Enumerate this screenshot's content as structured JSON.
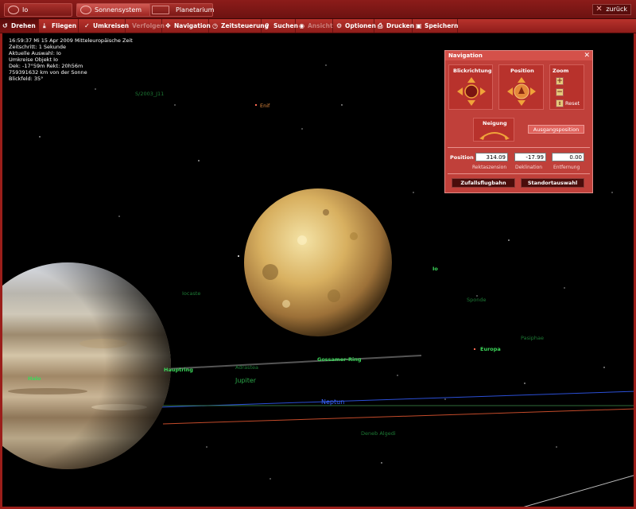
{
  "tabs": {
    "io": "Io",
    "sonnensystem": "Sonnensystem",
    "planetarium": "Planetarium",
    "back": "zurück"
  },
  "toolbar": {
    "drehen": "Drehen",
    "fliegen": "Fliegen",
    "umkreisen": "Umkreisen",
    "verfolgen": "Verfolgen",
    "navigation": "Navigation",
    "zeitsteuerung": "Zeitsteuerung",
    "suchen": "Suchen",
    "ansicht": "Ansicht",
    "optionen": "Optionen",
    "drucken": "Drucken",
    "speichern": "Speichern"
  },
  "info": {
    "line1": "16:59:37 Mi    15 Apr  2009 Mitteleuropäische Zeit",
    "line2": "Zeitschritt: 1 Sekunde",
    "line3": "Aktuelle Auswahl: Io",
    "line4": "Umkreise Objekt Io",
    "line5": "Dek: -17°59m Rekt: 20h56m",
    "line6": "759391632 km von der Sonne",
    "line7": "Blickfeld: 35°"
  },
  "labels": {
    "s2003": "S/2003_J11",
    "enif": "Enif",
    "io": "Io",
    "iocaste": "Iocaste",
    "sponde": "Sponde",
    "pasiphae": "Pasiphae",
    "europa": "Europa",
    "gossamer": "Gossamer-Ring",
    "hauptring": "Hauptring",
    "adrastea": "Adrastea",
    "jupiter": "Jupiter",
    "neptun": "Neptun",
    "deneb": "Deneb Algedi",
    "halo": "Halo"
  },
  "nav": {
    "title": "Navigation",
    "blickrichtung": "Blickrichtung",
    "position": "Position",
    "zoom": "Zoom",
    "reset": "Reset",
    "neigung": "Neigung",
    "ausgangsposition": "Ausgangsposition",
    "position_label": "Position",
    "rektaszension_value": "314.09",
    "deklination_value": "-17.99",
    "entfernung_value": "0.00",
    "rektaszension": "Rektaszension",
    "deklination": "Deklination",
    "entfernung": "Entfernung",
    "zufallsflugbahn": "Zufallsflugbahn",
    "standortauswahl": "Standortauswahl"
  }
}
